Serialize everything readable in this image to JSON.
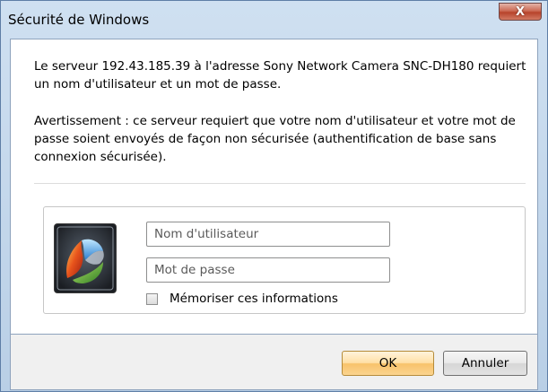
{
  "window": {
    "title": "Sécurité de Windows",
    "close_glyph": "X"
  },
  "message": {
    "line1": "Le serveur 192.43.185.39 à l'adresse Sony Network Camera SNC-DH180 requiert un nom d'utilisateur et un mot de passe.",
    "warning": "Avertissement : ce serveur requiert que votre nom d'utilisateur et votre mot de passe soient envoyés de façon non sécurisée (authentification de base sans connexion sécurisée)."
  },
  "credentials": {
    "avatar_icon": "user-tile-icon",
    "username_placeholder": "Nom d'utilisateur",
    "username_value": "",
    "password_placeholder": "Mot de passe",
    "password_value": "",
    "remember_label": "Mémoriser ces informations",
    "remember_checked": false
  },
  "buttons": {
    "ok_label": "OK",
    "cancel_label": "Annuler"
  },
  "colors": {
    "ok_accent": "#f8c26a",
    "close_button": "#b7432b"
  }
}
